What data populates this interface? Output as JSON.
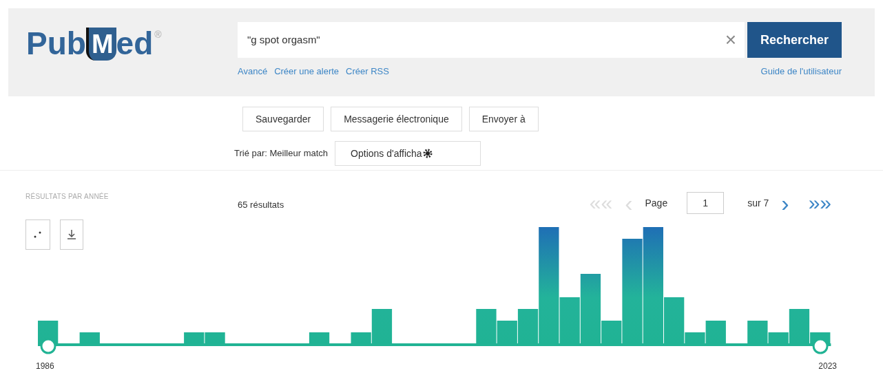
{
  "logo": {
    "text_left": "Pub",
    "text_right": "ed",
    "mark": "M",
    "registered": "®"
  },
  "search": {
    "value": "\"g spot orgasm\"",
    "clear": "×",
    "button": "Rechercher"
  },
  "links": [
    "Avancé",
    "Créer une alerte",
    "Créer RSS"
  ],
  "guide_link": "Guide de l'utilisateur",
  "actions": [
    "Sauvegarder",
    "Messagerie électronique",
    "Envoyer à"
  ],
  "sort_label": "Trié par: Meilleur match",
  "display_options": "Options d'afficha",
  "timeline": {
    "title": "RÉSULTATS PAR ANNÉE",
    "start_year": "1986",
    "end_year": "2023"
  },
  "results_count": "65 résultats",
  "pagination": {
    "first": "«",
    "prev": "‹",
    "page_label": "Page",
    "page": "1",
    "of": "sur 7",
    "next": "›",
    "last": "»"
  }
}
